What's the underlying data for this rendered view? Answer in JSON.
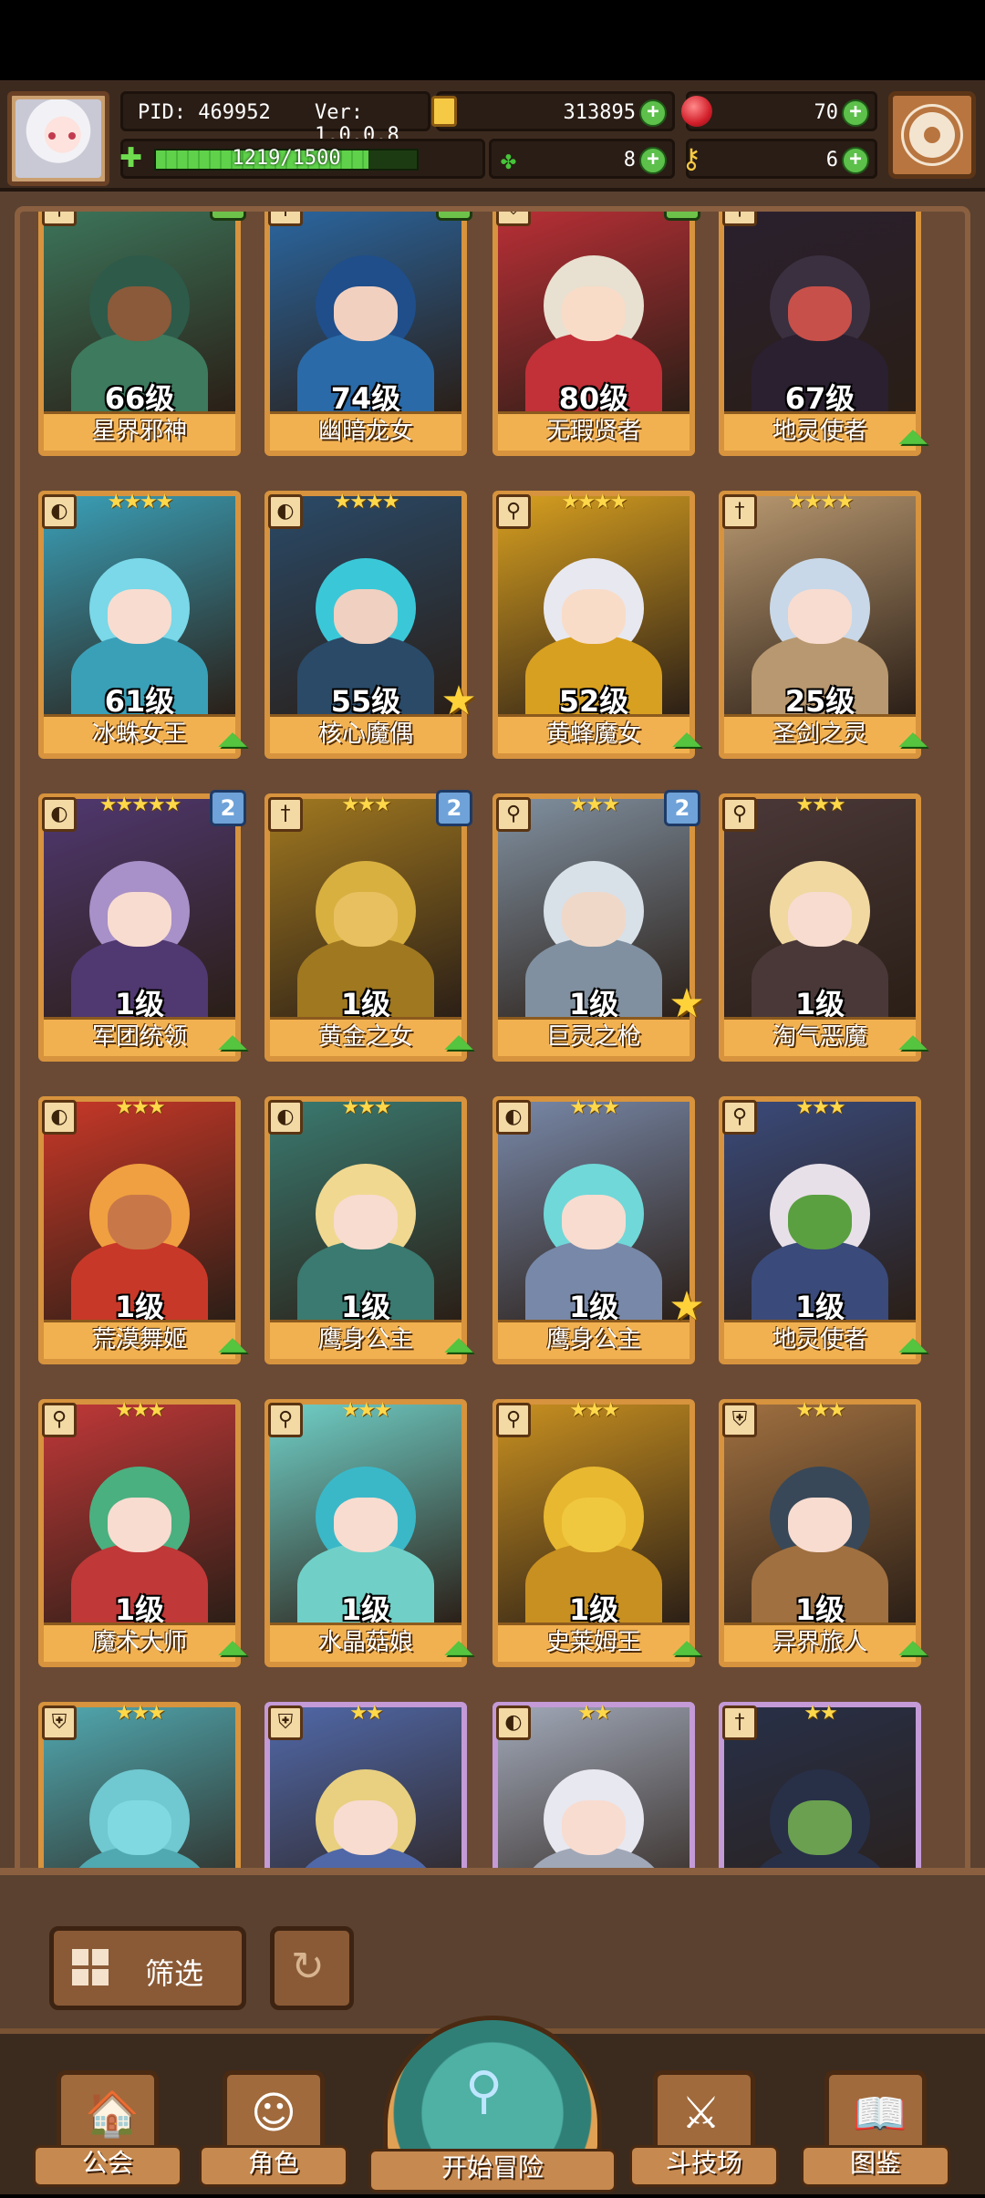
{
  "header": {
    "pid_label": "PID: 469952",
    "version_label": "Ver: 1.0.0.8",
    "gold": "313895",
    "gems": "70",
    "exp_text": "1219/1500",
    "exp_fraction": 0.813,
    "clovers": "8",
    "keys": "6"
  },
  "roster": [
    {
      "name": "星界邪神",
      "level": "66级",
      "stars": "★★★★★",
      "class": "wand",
      "rank": "1",
      "rank_color": "green",
      "art": [
        "#2e5a4a",
        "#8a5a3a",
        "#3d7a5e"
      ]
    },
    {
      "name": "幽暗龙女",
      "level": "74级",
      "stars": "★★★★★",
      "class": "sword",
      "rank": "1",
      "rank_color": "green",
      "art": [
        "#1f4e8a",
        "#f2d0c0",
        "#2a6aa8"
      ]
    },
    {
      "name": "无瑕贤者",
      "level": "80级",
      "stars": "★★★★★",
      "class": "shield",
      "rank": "1",
      "rank_color": "green",
      "art": [
        "#e8e0d0",
        "#f8dcc8",
        "#c23038"
      ]
    },
    {
      "name": "地灵使者",
      "level": "67级",
      "stars": "★★★★",
      "class": "wand",
      "rank": "",
      "rank_color": "",
      "art": [
        "#3a3040",
        "#c8504a",
        "#2a2030"
      ],
      "up": true
    },
    {
      "name": "冰蛛女王",
      "level": "61级",
      "stars": "★★★★",
      "class": "bow",
      "rank": "",
      "rank_color": "",
      "art": [
        "#7ad8e8",
        "#f8dcd0",
        "#3aa0b8"
      ],
      "up": true
    },
    {
      "name": "核心魔偶",
      "level": "55级",
      "stars": "★★★★",
      "class": "bow",
      "rank": "",
      "rank_color": "",
      "art": [
        "#3ac8d8",
        "#f0d0c0",
        "#2a4a68"
      ],
      "star": true
    },
    {
      "name": "黄蜂魔女",
      "level": "52级",
      "stars": "★★★★",
      "class": "wand",
      "rank": "",
      "rank_color": "",
      "art": [
        "#e8e8f0",
        "#f8dcc8",
        "#d8a020"
      ],
      "up": true
    },
    {
      "name": "圣剑之灵",
      "level": "25级",
      "stars": "★★★★",
      "class": "sword",
      "rank": "",
      "rank_color": "",
      "art": [
        "#c8d8e8",
        "#f8dcd0",
        "#b89870"
      ],
      "up": true
    },
    {
      "name": "军团统领",
      "level": "1级",
      "stars": "★★★★★",
      "class": "bow",
      "rank": "2",
      "rank_color": "blue",
      "art": [
        "#a890c8",
        "#f8dcd0",
        "#503870"
      ],
      "up": true
    },
    {
      "name": "黄金之女",
      "level": "1级",
      "stars": "★★★",
      "class": "sword",
      "rank": "2",
      "rank_color": "blue",
      "art": [
        "#d8b040",
        "#e8c060",
        "#a07820"
      ],
      "up": true
    },
    {
      "name": "巨灵之枪",
      "level": "1级",
      "stars": "★★★",
      "class": "wand",
      "rank": "2",
      "rank_color": "blue",
      "art": [
        "#d8e0e8",
        "#f0d8c8",
        "#8090a0"
      ],
      "star": true
    },
    {
      "name": "淘气恶魔",
      "level": "1级",
      "stars": "★★★",
      "class": "wand",
      "rank": "",
      "rank_color": "",
      "art": [
        "#f0d8a0",
        "#f8dcd0",
        "#4a3838"
      ],
      "up": true
    },
    {
      "name": "荒漠舞姬",
      "level": "1级",
      "stars": "★★★",
      "class": "bow",
      "rank": "",
      "rank_color": "",
      "art": [
        "#f0a040",
        "#c87848",
        "#c83828"
      ],
      "up": true
    },
    {
      "name": "鹰身公主",
      "level": "1级",
      "stars": "★★★",
      "class": "bow",
      "rank": "",
      "rank_color": "",
      "art": [
        "#f0d890",
        "#f8dcd0",
        "#3a7a70"
      ],
      "up": true
    },
    {
      "name": "鹰身公主",
      "level": "1级",
      "stars": "★★★",
      "class": "bow",
      "rank": "",
      "rank_color": "",
      "art": [
        "#70d8d8",
        "#f8dcd0",
        "#7888a8"
      ],
      "star": true
    },
    {
      "name": "地灵使者",
      "level": "1级",
      "stars": "★★★",
      "class": "wand",
      "rank": "",
      "rank_color": "",
      "art": [
        "#e8e0e8",
        "#5aa040",
        "#3a4a7a"
      ],
      "up": true
    },
    {
      "name": "魔术大师",
      "level": "1级",
      "stars": "★★★",
      "class": "wand",
      "rank": "",
      "rank_color": "",
      "art": [
        "#4ab080",
        "#f8dcd0",
        "#c03838"
      ],
      "up": true
    },
    {
      "name": "水晶菇娘",
      "level": "1级",
      "stars": "★★★",
      "class": "wand",
      "rank": "",
      "rank_color": "",
      "art": [
        "#3ab8c8",
        "#f8dcd0",
        "#70d0c8"
      ],
      "up": true
    },
    {
      "name": "史莱姆王",
      "level": "1级",
      "stars": "★★★",
      "class": "wand",
      "rank": "",
      "rank_color": "",
      "art": [
        "#e8b830",
        "#f0c840",
        "#c89020"
      ],
      "up": true
    },
    {
      "name": "异界旅人",
      "level": "1级",
      "stars": "★★★",
      "class": "shield",
      "rank": "",
      "rank_color": "",
      "art": [
        "#384858",
        "#f8dcd0",
        "#a07040"
      ],
      "up": true
    },
    {
      "name": "",
      "level": "",
      "stars": "★★★",
      "class": "shield",
      "rank": "",
      "rank_color": "",
      "art": [
        "#70c8d0",
        "#80d8e0",
        "#50a8b0"
      ]
    },
    {
      "name": "",
      "level": "",
      "stars": "★★",
      "class": "shield",
      "rank": "",
      "rank_color": "",
      "art": [
        "#e8d080",
        "#f8dcd0",
        "#5068a8"
      ],
      "purple": true
    },
    {
      "name": "",
      "level": "",
      "stars": "★★",
      "class": "bow",
      "rank": "",
      "rank_color": "",
      "art": [
        "#e8e8f0",
        "#f8dcd0",
        "#a0a8b8"
      ],
      "purple": true
    },
    {
      "name": "",
      "level": "",
      "stars": "★★",
      "class": "sword",
      "rank": "",
      "rank_color": "",
      "art": [
        "#283048",
        "#6aa050",
        "#283048"
      ],
      "purple": true
    }
  ],
  "controls": {
    "filter_label": "筛选"
  },
  "nav": {
    "guild": "公会",
    "character": "角色",
    "start": "开始冒险",
    "arena": "斗技场",
    "codex": "图鉴"
  }
}
